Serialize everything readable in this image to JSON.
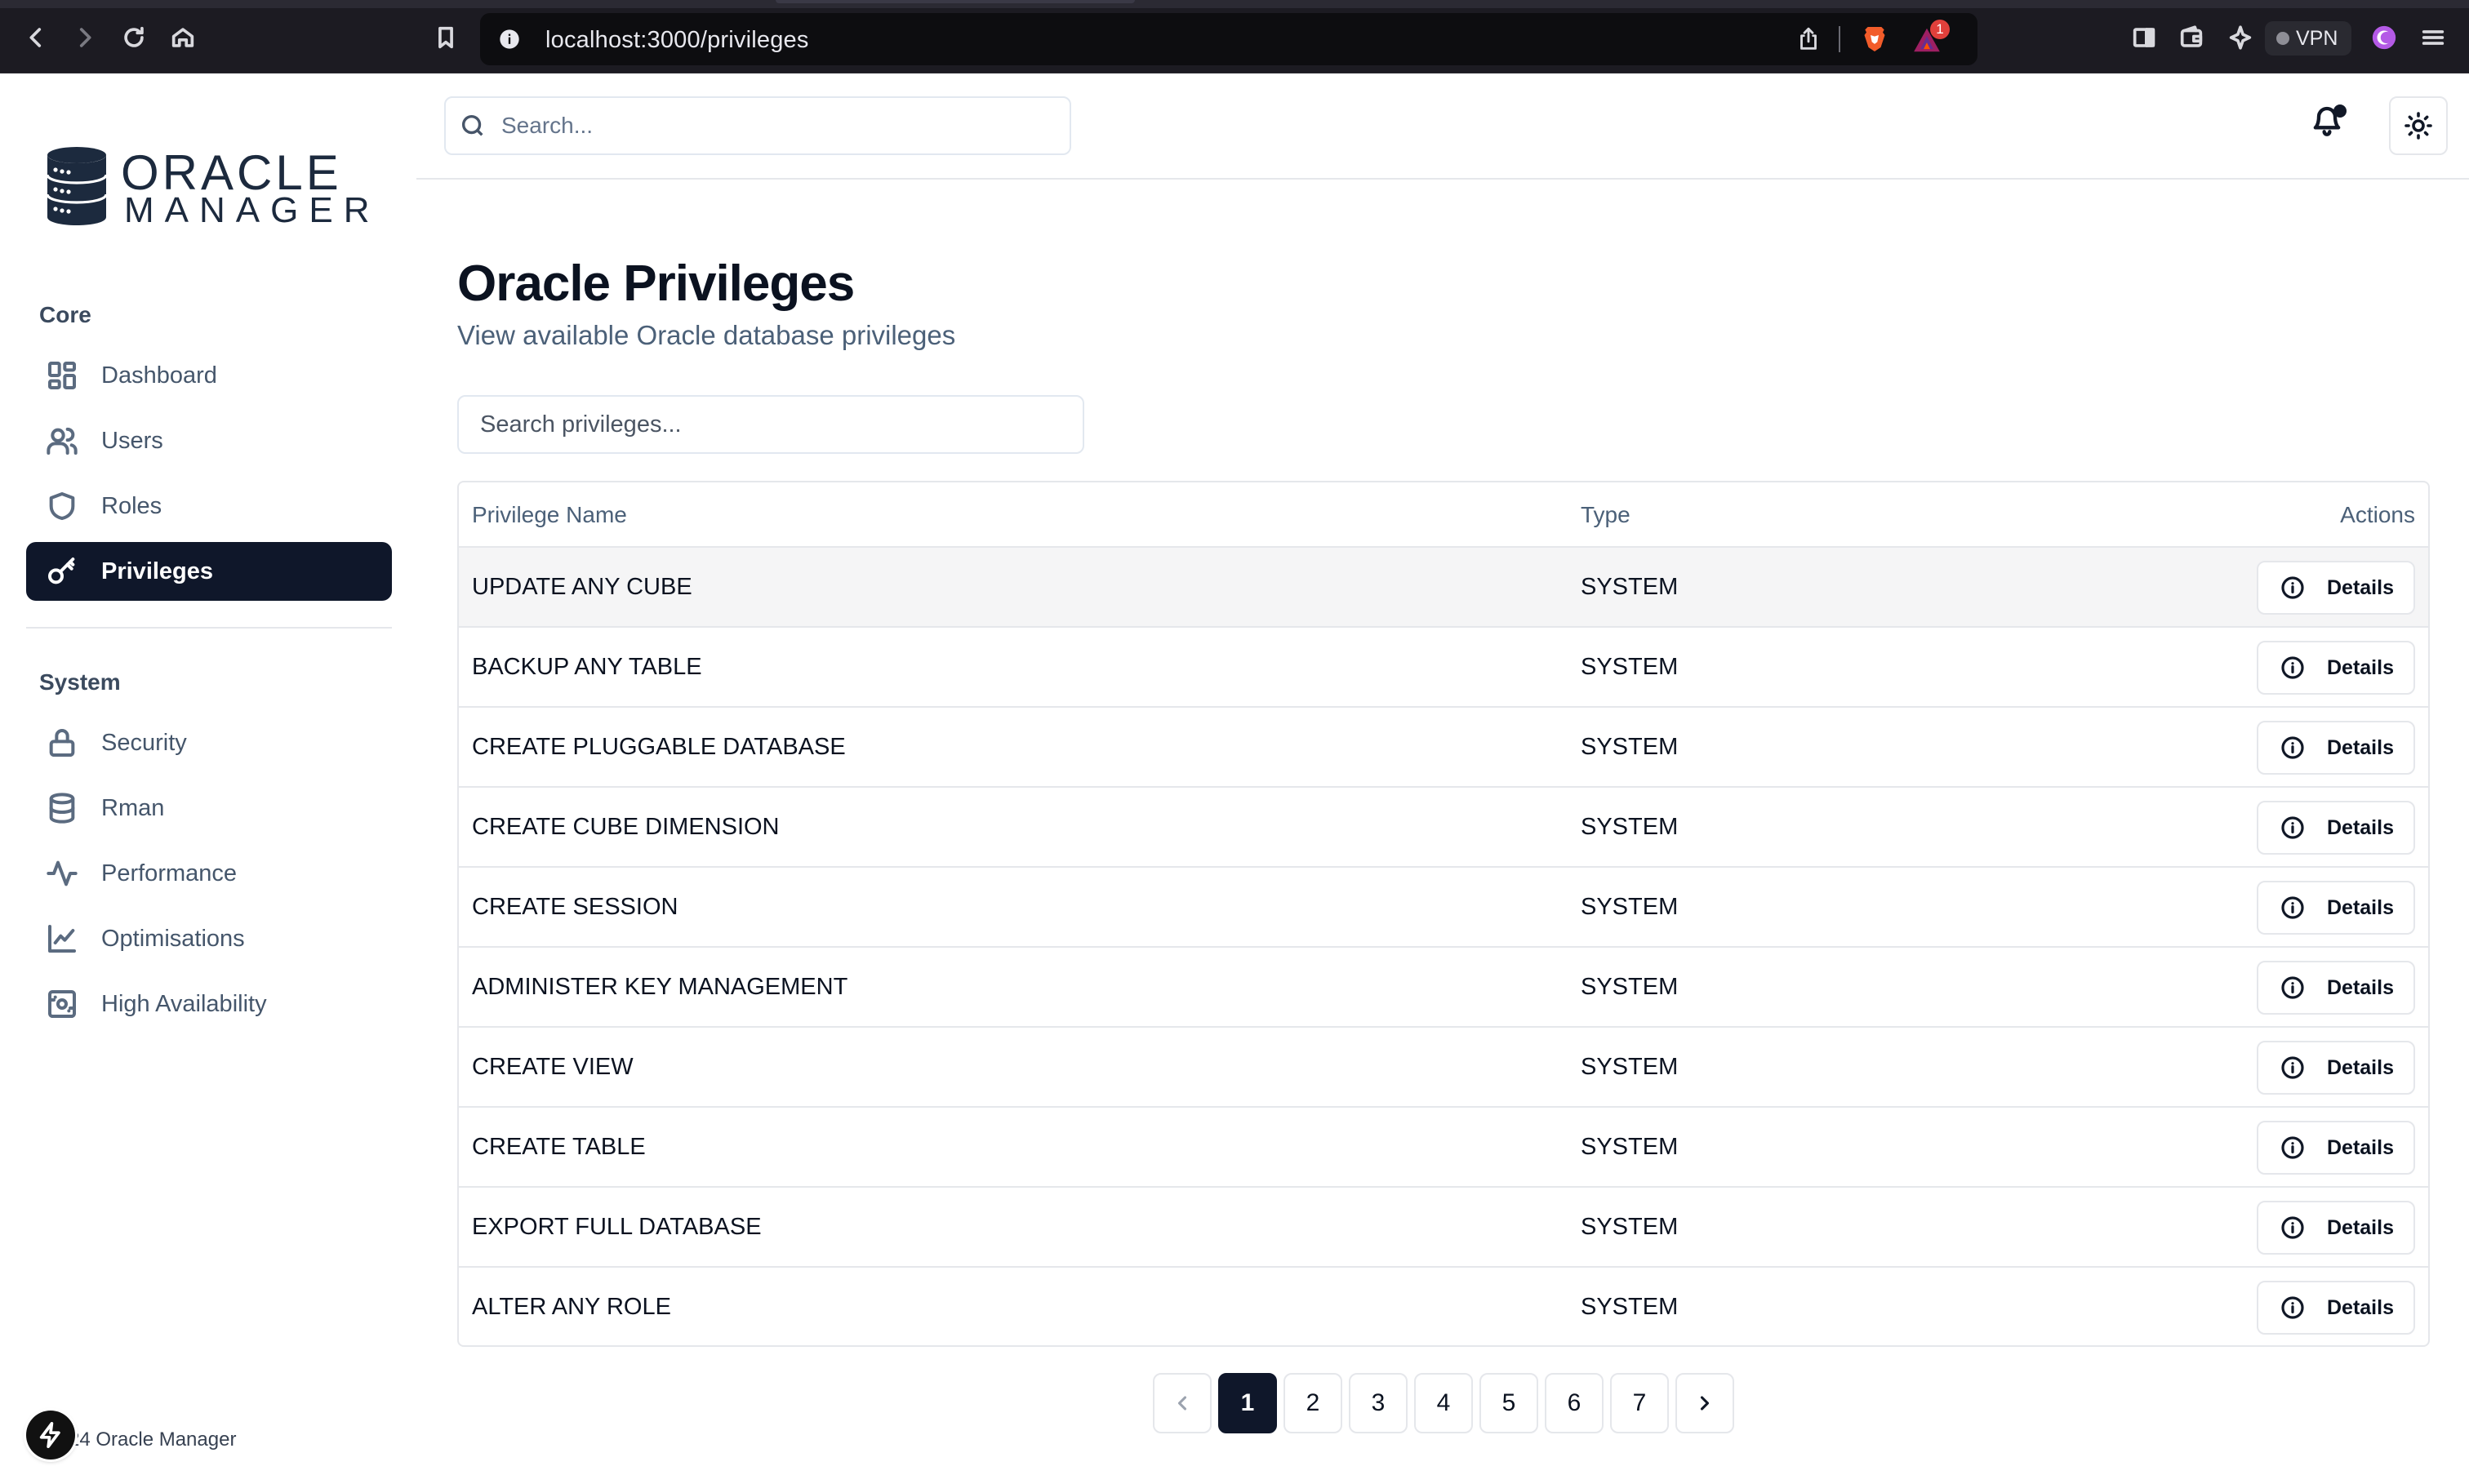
{
  "browser": {
    "url": "localhost:3000/privileges",
    "vpn_label": "VPN",
    "rewards_count": "1"
  },
  "sidebar": {
    "logo_line1": "ORACLE",
    "logo_line2": "MANAGER",
    "core_label": "Core",
    "core_items": [
      {
        "label": "Dashboard",
        "icon": "dashboard-icon"
      },
      {
        "label": "Users",
        "icon": "users-icon"
      },
      {
        "label": "Roles",
        "icon": "shield-icon"
      },
      {
        "label": "Privileges",
        "icon": "key-icon",
        "active": true
      }
    ],
    "system_label": "System",
    "system_items": [
      {
        "label": "Security",
        "icon": "lock-icon"
      },
      {
        "label": "Rman",
        "icon": "database-icon"
      },
      {
        "label": "Performance",
        "icon": "activity-icon"
      },
      {
        "label": "Optimisations",
        "icon": "line-chart-icon"
      },
      {
        "label": "High Availability",
        "icon": "server-cog-icon"
      }
    ],
    "footer": "24 Oracle Manager"
  },
  "header": {
    "search_placeholder": "Search..."
  },
  "main": {
    "title": "Oracle Privileges",
    "subtitle": "View available Oracle database privileges",
    "search_placeholder": "Search privileges...",
    "columns": [
      "Privilege Name",
      "Type",
      "Actions"
    ],
    "rows": [
      {
        "name": "UPDATE ANY CUBE",
        "type": "SYSTEM",
        "action": "Details"
      },
      {
        "name": "BACKUP ANY TABLE",
        "type": "SYSTEM",
        "action": "Details"
      },
      {
        "name": "CREATE PLUGGABLE DATABASE",
        "type": "SYSTEM",
        "action": "Details"
      },
      {
        "name": "CREATE CUBE DIMENSION",
        "type": "SYSTEM",
        "action": "Details"
      },
      {
        "name": "CREATE SESSION",
        "type": "SYSTEM",
        "action": "Details"
      },
      {
        "name": "ADMINISTER KEY MANAGEMENT",
        "type": "SYSTEM",
        "action": "Details"
      },
      {
        "name": "CREATE VIEW",
        "type": "SYSTEM",
        "action": "Details"
      },
      {
        "name": "CREATE TABLE",
        "type": "SYSTEM",
        "action": "Details"
      },
      {
        "name": "EXPORT FULL DATABASE",
        "type": "SYSTEM",
        "action": "Details"
      },
      {
        "name": "ALTER ANY ROLE",
        "type": "SYSTEM",
        "action": "Details"
      }
    ]
  },
  "pagination": {
    "pages": [
      "1",
      "2",
      "3",
      "4",
      "5",
      "6",
      "7"
    ],
    "current": "1"
  },
  "colors": {
    "primary": "#0f172a",
    "muted_text": "#4b6078",
    "border": "#e5e7eb",
    "browser_bg": "#1c1b22"
  }
}
